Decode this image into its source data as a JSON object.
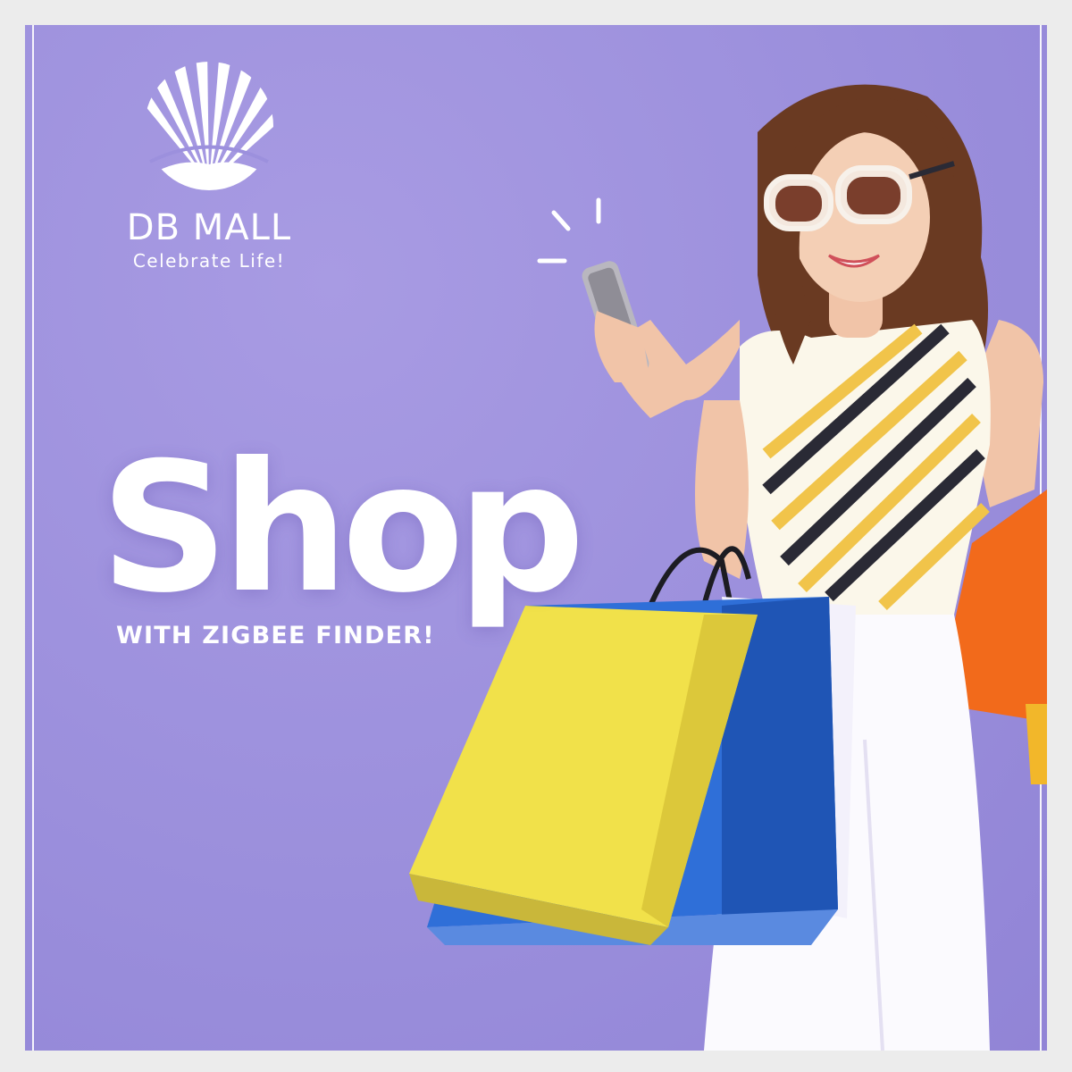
{
  "brand": {
    "name": "DB MALL",
    "tagline": "Celebrate Life!",
    "logo_icon": "sunburst-shell-icon"
  },
  "headline": "Shop",
  "subheadline": "WITH ZIGBEE FINDER!",
  "colors": {
    "background": "#9c90dd",
    "text": "#ffffff",
    "frame": "#ececec",
    "bag_yellow": "#f1e14a",
    "bag_blue": "#2f6fd8",
    "bag_orange": "#f26a1b"
  },
  "photo": {
    "subject": "woman-with-phone-and-shopping-bags"
  }
}
